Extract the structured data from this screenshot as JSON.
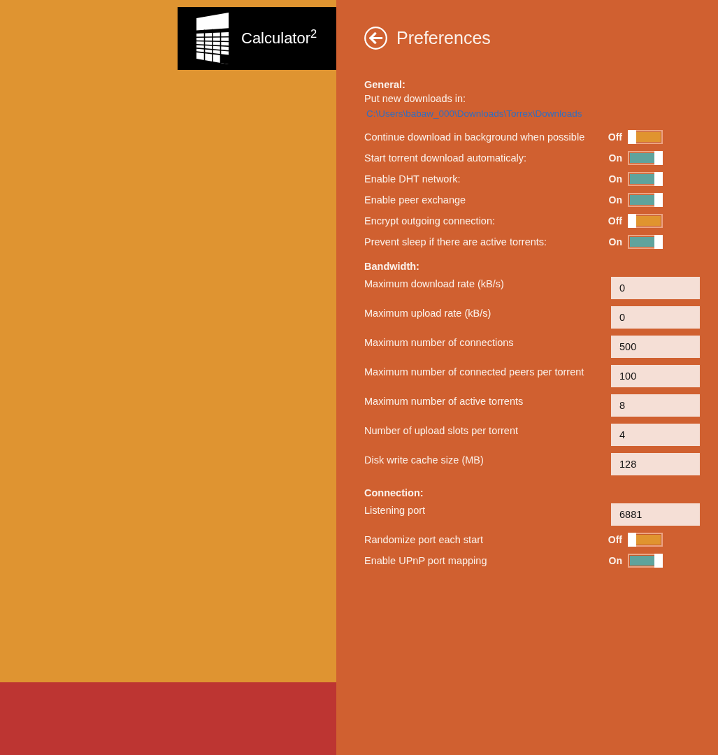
{
  "app_tile": {
    "title": "Calculator$^{2}$"
  },
  "header": {
    "title": "Preferences"
  },
  "sections": [
    {
      "heading": "General:",
      "items": [
        {
          "kind": "path",
          "label": "Put new downloads in:",
          "value": "C:\\Users\\babaw_000\\Downloads\\Torrex\\Downloads"
        },
        {
          "kind": "toggle",
          "label": "Continue download in background when possible",
          "on": false,
          "state_label": "Off"
        },
        {
          "kind": "toggle",
          "label": "Start torrent download automaticaly:",
          "on": true,
          "state_label": "On"
        },
        {
          "kind": "toggle",
          "label": "Enable DHT network:",
          "on": true,
          "state_label": "On"
        },
        {
          "kind": "toggle",
          "label": "Enable peer exchange",
          "on": true,
          "state_label": "On"
        },
        {
          "kind": "toggle",
          "label": "Encrypt outgoing connection:",
          "on": false,
          "state_label": "Off"
        },
        {
          "kind": "toggle",
          "label": "Prevent sleep if there are active torrents:",
          "on": true,
          "state_label": "On"
        }
      ]
    },
    {
      "heading": "Bandwidth:",
      "items": [
        {
          "kind": "number",
          "label": "Maximum download rate (kB/s)",
          "value": "0"
        },
        {
          "kind": "number",
          "label": "Maximum upload rate (kB/s)",
          "value": "0"
        },
        {
          "kind": "number",
          "label": "Maximum number of connections",
          "value": "500"
        },
        {
          "kind": "number",
          "label": "Maximum number of connected peers per torrent",
          "value": "100"
        },
        {
          "kind": "number",
          "label": "Maximum number of active torrents",
          "value": "8"
        },
        {
          "kind": "number",
          "label": "Number of upload slots per torrent",
          "value": "4"
        },
        {
          "kind": "number",
          "label": "Disk write cache size (MB)",
          "value": "128"
        }
      ]
    },
    {
      "heading": "Connection:",
      "items": [
        {
          "kind": "number",
          "label": "Listening port",
          "value": "6881"
        },
        {
          "kind": "toggle",
          "label": "Randomize port each start",
          "on": false,
          "state_label": "Off"
        },
        {
          "kind": "toggle",
          "label": "Enable UPnP port mapping",
          "on": true,
          "state_label": "On"
        }
      ]
    }
  ]
}
